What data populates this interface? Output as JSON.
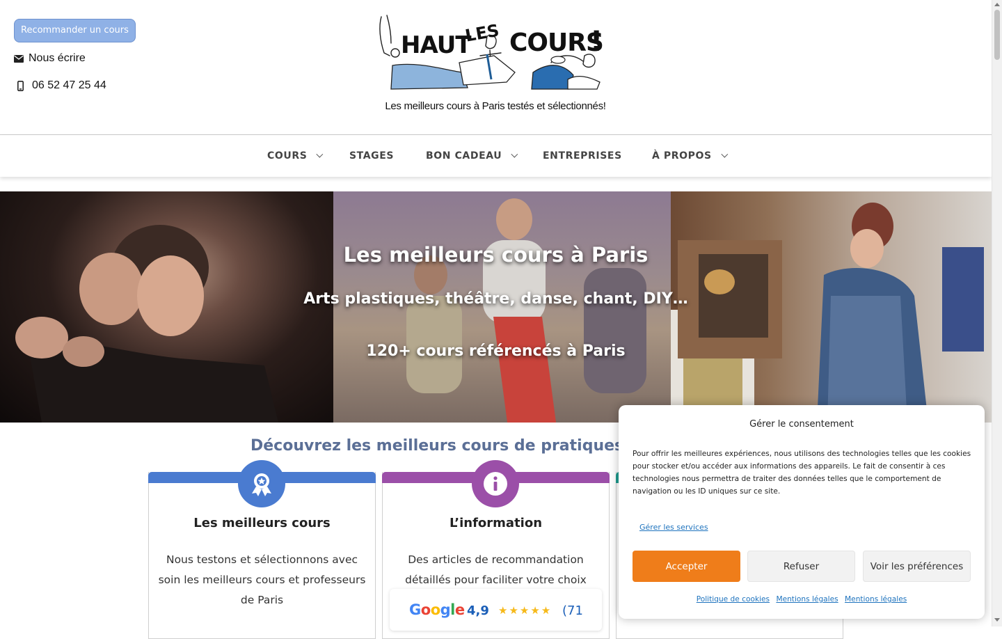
{
  "header": {
    "recommend_button": "Recommander un cours",
    "email_label": "Nous écrire",
    "phone": "06 52 47 25 44",
    "logo_text": "HAUT LES COURS !",
    "tagline": "Les meilleurs cours à Paris testés et sélectionnés!"
  },
  "nav": {
    "items": [
      {
        "label": "COURS",
        "has_dropdown": true
      },
      {
        "label": "STAGES",
        "has_dropdown": false
      },
      {
        "label": "BON CADEAU",
        "has_dropdown": true
      },
      {
        "label": "ENTREPRISES",
        "has_dropdown": false
      },
      {
        "label": "À PROPOS",
        "has_dropdown": true
      }
    ]
  },
  "hero": {
    "title": "Les meilleurs cours à Paris",
    "subtitle": "Arts plastiques, théâtre, danse, chant, DIY…",
    "count": "120+ cours référencés à Paris"
  },
  "section": {
    "title": "Découvrez les meilleurs cours de pratiques art",
    "cards": [
      {
        "title": "Les meilleurs cours",
        "text": "Nous testons et sélectionnons avec soin les meilleurs cours et professeurs de Paris",
        "color": "#4a7bd0",
        "icon": "award-ribbon-icon"
      },
      {
        "title": "L’information",
        "text": "Des articles de recommandation détaillés pour faciliter votre choix",
        "color": "#9b4fa8",
        "icon": "info-icon"
      },
      {
        "title": "",
        "text": "",
        "color": "#1f9c8f",
        "icon": ""
      }
    ]
  },
  "google_widget": {
    "brand": "Google",
    "rating": "4,9",
    "stars": "★★★★★",
    "count": "(71"
  },
  "consent": {
    "title": "Gérer le consentement",
    "body": "Pour offrir les meilleures expériences, nous utilisons des technologies telles que les cookies pour stocker et/ou accéder aux informations des appareils. Le fait de consentir à ces technologies nous permettra de traiter des données telles que le comportement de navigation ou les ID uniques sur ce site.",
    "manage_services": "Gérer les services",
    "accept": "Accepter",
    "refuse": "Refuser",
    "preferences": "Voir les préférences",
    "links": [
      "Politique de cookies",
      "Mentions légales",
      "Mentions légales"
    ]
  },
  "colors": {
    "accent_orange": "#ef7d1a",
    "link_blue": "#1e73be",
    "section_title": "#5b6f96",
    "card_blue": "#4a7bd0",
    "card_purple": "#9b4fa8",
    "card_teal": "#1f9c8f"
  }
}
